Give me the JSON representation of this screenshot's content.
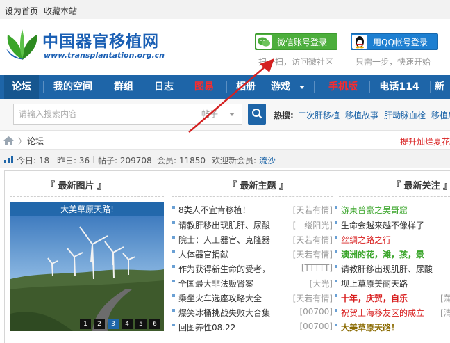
{
  "topbar": {
    "set_home": "设为首页",
    "bookmark": "收藏本站"
  },
  "logo": {
    "title": "中国器官移植网",
    "url": "www.transplantation.org.cn"
  },
  "login": {
    "wechat_label": "微信账号登录",
    "wechat_hint": "扫一扫，访问微社区",
    "qq_label": "用QQ帐号登录",
    "qq_hint": "只需一步，快速开始"
  },
  "nav": {
    "items": [
      {
        "label": "论坛"
      },
      {
        "label": "我的空间"
      },
      {
        "label": "群组"
      },
      {
        "label": "日志"
      },
      {
        "label": "图易"
      },
      {
        "label": "相册"
      },
      {
        "label": "游戏"
      },
      {
        "label": "手机版"
      },
      {
        "label": "电话114"
      },
      {
        "label": "新"
      }
    ],
    "active": "论坛",
    "red_items": [
      "图易",
      "手机版"
    ],
    "colors": {
      "bar": "#1e65a8",
      "red": "#ff2a2a"
    }
  },
  "search": {
    "placeholder": "请输入搜索内容",
    "type_value": "帖子",
    "hot_label": "热搜:",
    "hot_items": [
      "二次肝移植",
      "移植故事",
      "肝动脉血栓",
      "移植后"
    ]
  },
  "breadcrumb": {
    "current": "论坛",
    "separator": "〉",
    "promo": "提升灿烂夏花"
  },
  "stats": {
    "today_label": "今日:",
    "today": "18",
    "yesterday_label": "昨日:",
    "yesterday": "36",
    "posts_label": "帖子:",
    "posts": "209708",
    "members_label": "会员:",
    "members": "11850",
    "welcome_label": "欢迎新会员:",
    "newest_member": "流沙"
  },
  "portal": {
    "latest_images_title": "『 最新图片 』",
    "latest_topics_title": "『 最新主题 』",
    "latest_focus_title": "『 最新关注 』",
    "slide_caption": "大美草原天路!",
    "slide_pages": [
      "1",
      "2",
      "3",
      "4",
      "5",
      "6"
    ],
    "slide_current": "3",
    "topics": [
      {
        "title": "8类人不宜肯移植！",
        "author": "[天若有情]"
      },
      {
        "title": "请教肝移出现肌肝、尿酸",
        "author": "[一缕阳光]"
      },
      {
        "title": "院士：人工器官、克隆器",
        "author": "[天若有情]"
      },
      {
        "title": "人体器官捐献",
        "author": "[天若有情]"
      },
      {
        "title": "作为获得新生命的受者，",
        "author": "[TTTTT]"
      },
      {
        "title": "全国最大非法贩肾案",
        "author": "[大光]"
      },
      {
        "title": "乘坐火车选座攻略大全",
        "author": "[天若有情]"
      },
      {
        "title": "爆笑冰桶挑战失败大合集",
        "author": "[00700]"
      },
      {
        "title": "回图养性08.22",
        "author": "[00700]"
      }
    ],
    "focus": [
      {
        "title": "游東普豪之吴哥窟",
        "color": "#3aa52a",
        "author": ""
      },
      {
        "title": "生命会越来越不像样了",
        "color": "#333333",
        "author": ""
      },
      {
        "title": "丝绸之路之行",
        "color": "#d81e1e",
        "author": ""
      },
      {
        "title": "澳洲的花，滩，孩，景",
        "color": "#3aa52a",
        "author": ""
      },
      {
        "title": "请教肝移出现肌肝、尿酸",
        "color": "#333333",
        "author": ""
      },
      {
        "title": "坝上草原美丽天路",
        "color": "#333333",
        "author": ""
      },
      {
        "title": "十年，庆贺，自乐",
        "color": "#d81e1e",
        "author": "[蒲"
      },
      {
        "title": "祝贺上海移友区的成立",
        "color": "#d81e1e",
        "author": "[清"
      },
      {
        "title": "大美草原天路！",
        "color": "#8a6a00",
        "author": ""
      }
    ]
  }
}
